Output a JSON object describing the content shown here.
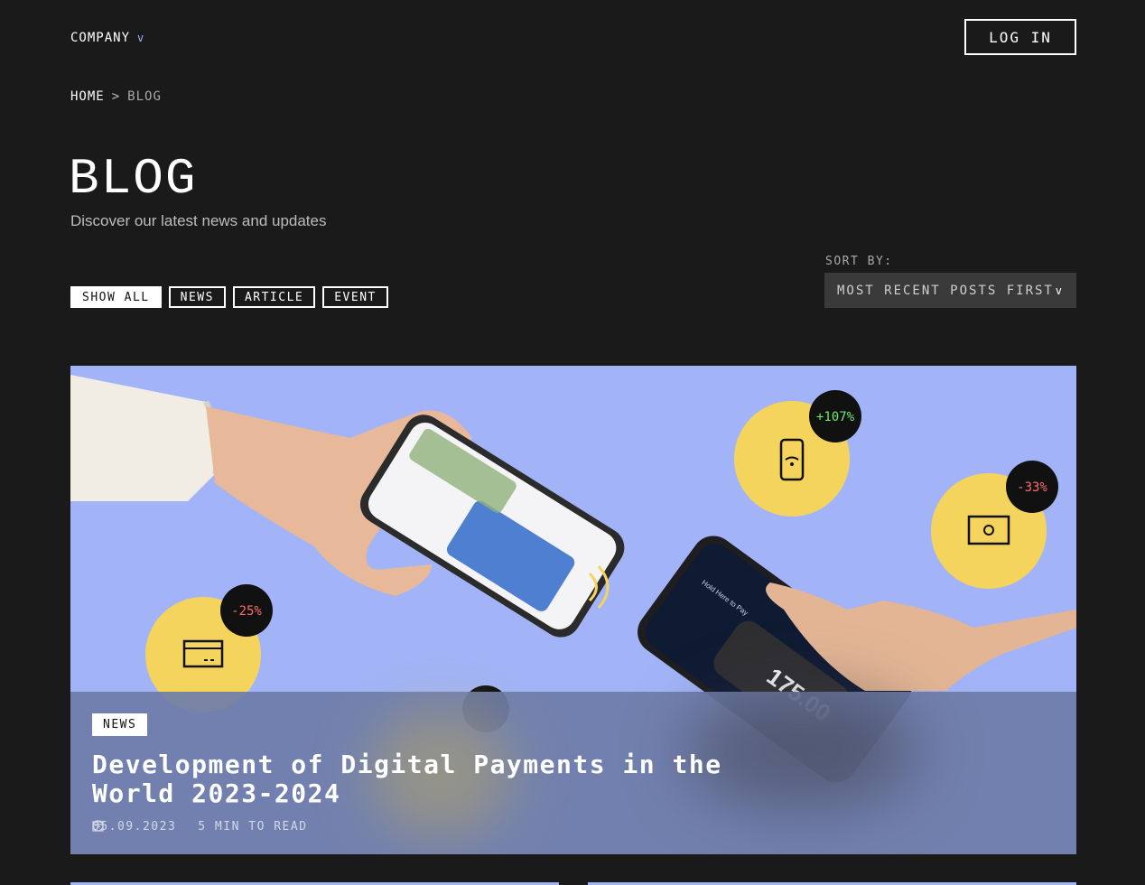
{
  "header": {
    "company_label": "COMPANY",
    "company_chevron": "v",
    "login_label": "LOG IN"
  },
  "breadcrumb": {
    "home": "HOME",
    "separator": ">",
    "current": "BLOG"
  },
  "page": {
    "title": "BLOG",
    "subtitle": "Discover our latest news and updates"
  },
  "filters": [
    {
      "label": "SHOW ALL",
      "active": true
    },
    {
      "label": "NEWS",
      "active": false
    },
    {
      "label": "ARTICLE",
      "active": false
    },
    {
      "label": "EVENT",
      "active": false
    }
  ],
  "sort": {
    "label": "SORT BY:",
    "value": "MOST RECENT POSTS FIRST",
    "chevron": "v"
  },
  "featured_post": {
    "tag": "NEWS",
    "title": "Development of Digital Payments in the World 2023-2024",
    "date": "05.09.2023",
    "read_time": "5 MIN TO READ",
    "image_badges": [
      "+107%",
      "-33%",
      "-25%"
    ],
    "image_phone_amount": "175.00",
    "image_phone_text": "Hold Here to Pay"
  },
  "colors": {
    "background": "#1a1a1a",
    "hero_background": "#a2b4f7",
    "accent_yellow": "#f5d45e",
    "positive_green": "#6ee96e",
    "negative_red": "#ff6b6b",
    "chevron_blue": "#a4b6ff"
  },
  "icons": [
    "chevron-down-icon",
    "calendar-icon",
    "clock-icon",
    "phone-wifi-icon",
    "banknote-icon",
    "credit-card-icon"
  ]
}
